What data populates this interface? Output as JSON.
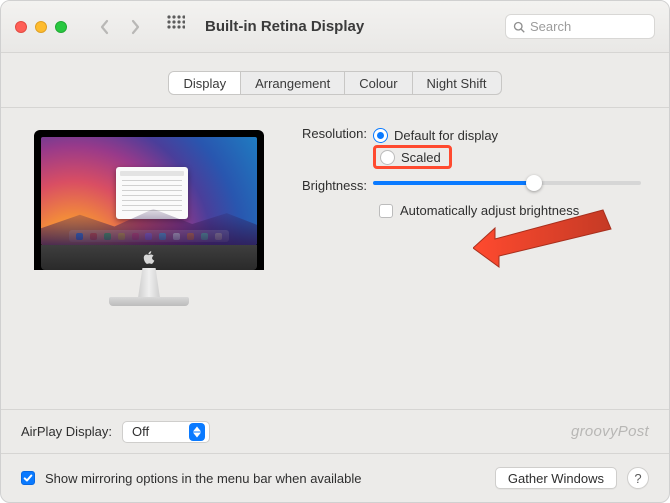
{
  "window": {
    "title": "Built-in Retina Display"
  },
  "search": {
    "placeholder": "Search"
  },
  "tabs": [
    {
      "label": "Display",
      "active": true
    },
    {
      "label": "Arrangement",
      "active": false
    },
    {
      "label": "Colour",
      "active": false
    },
    {
      "label": "Night Shift",
      "active": false
    }
  ],
  "resolution": {
    "label": "Resolution:",
    "options": {
      "default": "Default for display",
      "scaled": "Scaled"
    },
    "selected": "default"
  },
  "brightness": {
    "label": "Brightness:",
    "value_percent": 60,
    "auto_label": "Automatically adjust brightness",
    "auto_checked": false
  },
  "airplay": {
    "label": "AirPlay Display:",
    "value": "Off"
  },
  "mirroring": {
    "label": "Show mirroring options in the menu bar when available",
    "checked": true
  },
  "buttons": {
    "gather": "Gather Windows",
    "help": "?"
  },
  "watermark": "groovyPost"
}
